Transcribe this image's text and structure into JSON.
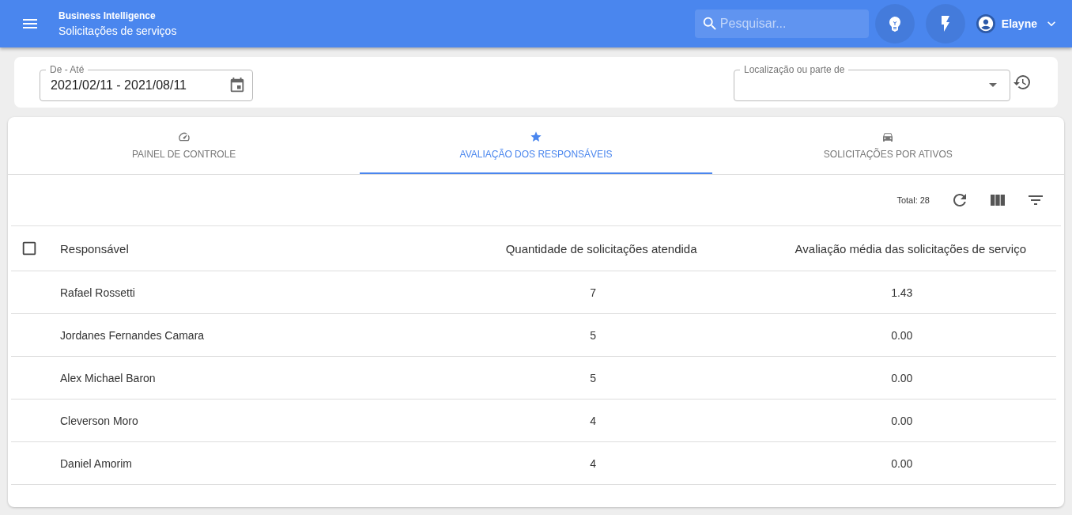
{
  "header": {
    "subtitle": "Business Intelligence",
    "title": "Solicitações de serviços",
    "search": {
      "placeholder": "Pesquisar..."
    },
    "user": "Elayne"
  },
  "filters": {
    "date_range": {
      "label": "De - Até",
      "value": "2021/02/11 - 2021/08/11"
    },
    "location": {
      "label": "Localização ou parte de"
    }
  },
  "tabs": [
    {
      "label": "PAINEL DE CONTROLE",
      "kind": "gauge",
      "selected": false
    },
    {
      "label": "AVALIAÇÃO DOS RESPONSÁVEIS",
      "kind": "star",
      "selected": true
    },
    {
      "label": "SOLICITAÇÕES POR ATIVOS",
      "kind": "car",
      "selected": false
    }
  ],
  "table": {
    "total": "Total: 28",
    "select_all": {
      "checked": false
    },
    "columns": [
      "Responsável",
      "Quantidade de solicitações atendida",
      "Avaliação média das solicitações de serviço"
    ],
    "rows": [
      [
        "Rafael Rossetti",
        "7",
        "1.43"
      ],
      [
        "Jordanes Fernandes Camara",
        "5",
        "0.00"
      ],
      [
        "Alex Michael Baron",
        "5",
        "0.00"
      ],
      [
        "Cleverson Moro",
        "4",
        "0.00"
      ],
      [
        "Daniel Amorim",
        "4",
        "0.00"
      ]
    ]
  }
}
